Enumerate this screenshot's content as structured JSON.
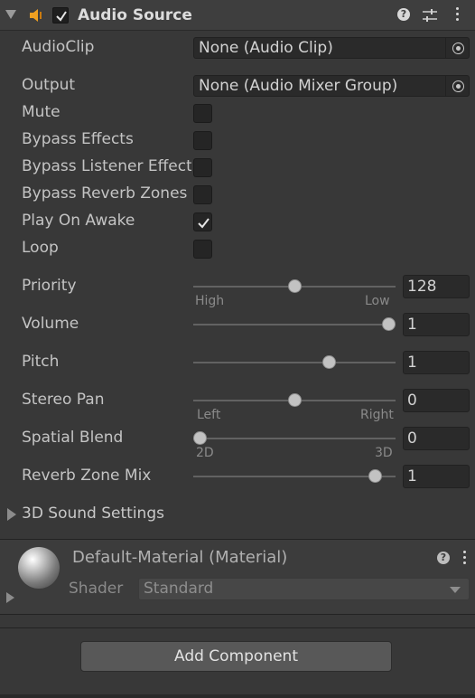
{
  "header": {
    "title": "Audio Source",
    "enabled": true,
    "component_icon": "speaker-icon",
    "help_label": "?"
  },
  "fields": {
    "audioclip": {
      "label": "AudioClip",
      "value": "None (Audio Clip)"
    },
    "output": {
      "label": "Output",
      "value": "None (Audio Mixer Group)"
    }
  },
  "toggles": [
    {
      "label": "Mute",
      "checked": false
    },
    {
      "label": "Bypass Effects",
      "checked": false
    },
    {
      "label": "Bypass Listener Effects",
      "checked": false
    },
    {
      "label": "Bypass Reverb Zones",
      "checked": false
    },
    {
      "label": "Play On Awake",
      "checked": true
    },
    {
      "label": "Loop",
      "checked": false
    }
  ],
  "sliders": {
    "priority": {
      "label": "Priority",
      "value": "128",
      "fraction": 0.5,
      "min_label": "High",
      "max_label": "Low"
    },
    "volume": {
      "label": "Volume",
      "value": "1",
      "fraction": 1.0
    },
    "pitch": {
      "label": "Pitch",
      "value": "1",
      "fraction": 0.67
    },
    "stereo_pan": {
      "label": "Stereo Pan",
      "value": "0",
      "fraction": 0.5,
      "min_label": "Left",
      "max_label": "Right"
    },
    "spatial_blend": {
      "label": "Spatial Blend",
      "value": "0",
      "fraction": 0.0,
      "min_label": "2D",
      "max_label": "3D"
    },
    "reverb_zone_mix": {
      "label": "Reverb Zone Mix",
      "value": "1",
      "fraction": 0.9
    }
  },
  "sound_settings": {
    "label": "3D Sound Settings"
  },
  "material": {
    "title": "Default-Material (Material)",
    "shader_label": "Shader",
    "shader_value": "Standard",
    "help_label": "?"
  },
  "add_component": {
    "label": "Add Component"
  },
  "colors": {
    "background": "#383838",
    "field": "#2a2a2a",
    "text": "#c4c4c4"
  }
}
